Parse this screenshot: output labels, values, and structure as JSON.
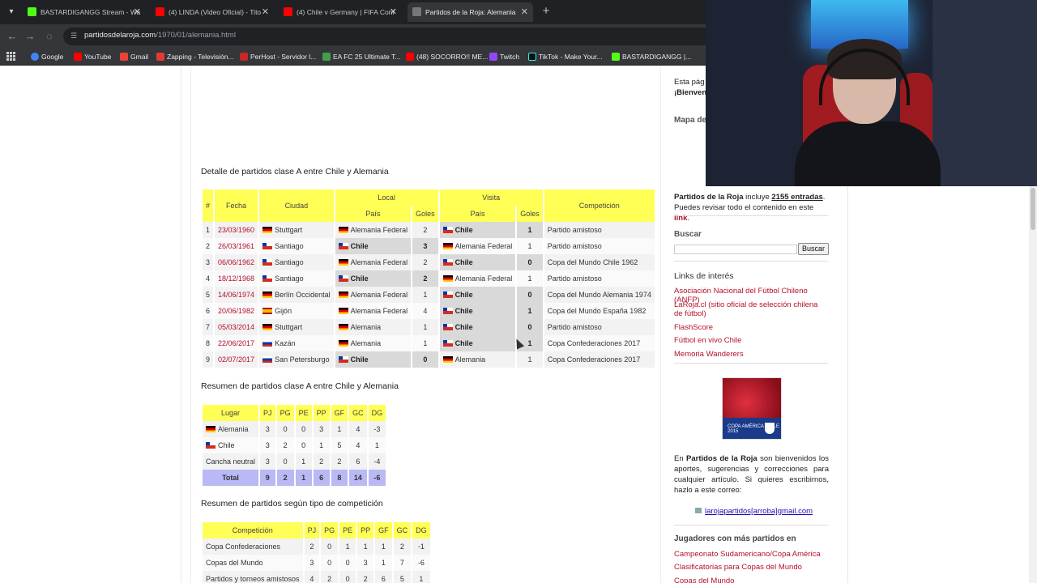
{
  "browser": {
    "tabs": [
      {
        "title": "BASTARDIGANGG Stream - Wa",
        "color": "#53fc18"
      },
      {
        "title": "(4) LINDA (Video Oficial) - Tito",
        "color": "#ff0000"
      },
      {
        "title": "(4) Chile v Germany | FIFA Conf",
        "color": "#ff0000"
      },
      {
        "title": "Partidos de la Roja: Alemania",
        "color": "#777777"
      }
    ],
    "url_host": "partidosdelaroja.com",
    "url_path": "/1970/01/alemania.html",
    "bookmarks": [
      {
        "label": "Google",
        "color": "#4285f4"
      },
      {
        "label": "YouTube",
        "color": "#ff0000"
      },
      {
        "label": "Gmail",
        "color": "#ea4335"
      },
      {
        "label": "Zapping - Televisión...",
        "color": "#e53935"
      },
      {
        "label": "PerHost - Servidor l...",
        "color": "#c62828"
      },
      {
        "label": "EA FC 25 Ultimate T...",
        "color": "#43a047"
      },
      {
        "label": "(48) SOCORRO!! ME...",
        "color": "#ff0000"
      },
      {
        "label": "Twitch",
        "color": "#9146ff"
      },
      {
        "label": "TikTok - Make Your...",
        "color": "#111111"
      },
      {
        "label": "BASTARDIGANGG |...",
        "color": "#53fc18"
      }
    ]
  },
  "detail": {
    "title": "Detalle de partidos clase A entre Chile y Alemania",
    "headers": {
      "num": "#",
      "date": "Fecha",
      "city": "Ciudad",
      "local": "Local",
      "visit": "Visita",
      "country": "País",
      "goals": "Goles",
      "competition": "Competición"
    },
    "rows": [
      {
        "n": "1",
        "date": "23/03/1960",
        "city": "Stuttgart",
        "city_flag": "de",
        "home": "Alemania Federal",
        "home_flag": "de",
        "hg": "2",
        "away": "Chile",
        "away_flag": "cl",
        "ag": "1",
        "comp": "Partido amistoso",
        "winner": "home"
      },
      {
        "n": "2",
        "date": "26/03/1961",
        "city": "Santiago",
        "city_flag": "cl",
        "home": "Chile",
        "home_flag": "cl",
        "hg": "3",
        "away": "Alemania Federal",
        "away_flag": "de",
        "ag": "1",
        "comp": "Partido amistoso",
        "winner": "home"
      },
      {
        "n": "3",
        "date": "06/06/1962",
        "city": "Santiago",
        "city_flag": "cl",
        "home": "Alemania Federal",
        "home_flag": "de",
        "hg": "2",
        "away": "Chile",
        "away_flag": "cl",
        "ag": "0",
        "comp": "Copa del Mundo Chile 1962",
        "winner": "home"
      },
      {
        "n": "4",
        "date": "18/12/1968",
        "city": "Santiago",
        "city_flag": "cl",
        "home": "Chile",
        "home_flag": "cl",
        "hg": "2",
        "away": "Alemania Federal",
        "away_flag": "de",
        "ag": "1",
        "comp": "Partido amistoso",
        "winner": "home"
      },
      {
        "n": "5",
        "date": "14/06/1974",
        "city": "Berlín Occidental",
        "city_flag": "de",
        "home": "Alemania Federal",
        "home_flag": "de",
        "hg": "1",
        "away": "Chile",
        "away_flag": "cl",
        "ag": "0",
        "comp": "Copa del Mundo Alemania 1974",
        "winner": "home"
      },
      {
        "n": "6",
        "date": "20/06/1982",
        "city": "Gijón",
        "city_flag": "es",
        "home": "Alemania Federal",
        "home_flag": "de",
        "hg": "4",
        "away": "Chile",
        "away_flag": "cl",
        "ag": "1",
        "comp": "Copa del Mundo España 1982",
        "winner": "home"
      },
      {
        "n": "7",
        "date": "05/03/2014",
        "city": "Stuttgart",
        "city_flag": "de",
        "home": "Alemania",
        "home_flag": "de",
        "hg": "1",
        "away": "Chile",
        "away_flag": "cl",
        "ag": "0",
        "comp": "Partido amistoso",
        "winner": "home"
      },
      {
        "n": "8",
        "date": "22/06/2017",
        "city": "Kazán",
        "city_flag": "ru",
        "home": "Alemania",
        "home_flag": "de",
        "hg": "1",
        "away": "Chile",
        "away_flag": "cl",
        "ag": "1",
        "comp": "Copa Confederaciones 2017",
        "winner": "none"
      },
      {
        "n": "9",
        "date": "02/07/2017",
        "city": "San Petersburgo",
        "city_flag": "ru",
        "home": "Chile",
        "home_flag": "cl",
        "hg": "0",
        "away": "Alemania",
        "away_flag": "de",
        "ag": "1",
        "comp": "Copa Confederaciones 2017",
        "winner": "home"
      }
    ]
  },
  "summary": {
    "title": "Resumen de partidos clase A entre Chile y Alemania",
    "headers": [
      "Lugar",
      "PJ",
      "PG",
      "PE",
      "PP",
      "GF",
      "GC",
      "DG"
    ],
    "rows": [
      {
        "label": "Alemania",
        "flag": "de",
        "vals": [
          "3",
          "0",
          "0",
          "3",
          "1",
          "4",
          "-3"
        ]
      },
      {
        "label": "Chile",
        "flag": "cl",
        "vals": [
          "3",
          "2",
          "0",
          "1",
          "5",
          "4",
          "1"
        ]
      },
      {
        "label": "Cancha neutral",
        "flag": "",
        "vals": [
          "3",
          "0",
          "1",
          "2",
          "2",
          "6",
          "-4"
        ]
      }
    ],
    "total": {
      "label": "Total",
      "vals": [
        "9",
        "2",
        "1",
        "6",
        "8",
        "14",
        "-6"
      ]
    }
  },
  "competition": {
    "title": "Resumen de partidos según tipo de competición",
    "headers": [
      "Competición",
      "PJ",
      "PG",
      "PE",
      "PP",
      "GF",
      "GC",
      "DG"
    ],
    "rows": [
      {
        "label": "Copa Confederaciones",
        "vals": [
          "2",
          "0",
          "1",
          "1",
          "1",
          "2",
          "-1"
        ]
      },
      {
        "label": "Copas del Mundo",
        "vals": [
          "3",
          "0",
          "0",
          "3",
          "1",
          "7",
          "-6"
        ]
      },
      {
        "label": "Partidos y torneos amistosos",
        "vals": [
          "4",
          "2",
          "0",
          "2",
          "6",
          "5",
          "1"
        ]
      }
    ]
  },
  "sidebar": {
    "intro_fragment": "Esta pág",
    "welcome_fragment": "¡Bienveni",
    "map_heading_fragment": "Mapa de",
    "entries_prefix": "Partidos de la Roja",
    "entries_mid": " incluye ",
    "entries_count": "2155 entradas",
    "entries_line2": "Puedes revisar todo el contenido en este ",
    "entries_link": "link",
    "search_heading": "Buscar",
    "search_button": "Buscar",
    "links_heading": "Links de interés",
    "links": [
      "Asociación Nacional del Fútbol Chileno (ANFP)",
      "LaRoja.cl (sitio oficial de selección chilena de fútbol)",
      "FlashScore",
      "Fútbol en vivo Chile",
      "Memoria Wanderers"
    ],
    "promo_caption": "COPA AMÉRICA CHILE 2015",
    "welcome_text_1": "En ",
    "welcome_brand": "Partidos de la Roja",
    "welcome_text_2": " son bienvenidos los aportes, sugerencias y correcciones para cualquier artículo. Si quieres escribirnos, hazlo a este correo:",
    "email": "larojapartidos[arroba]gmail.com",
    "players_heading": "Jugadores con más partidos en",
    "player_links": [
      "Campeonato Sudamericano/Copa América",
      "Clasificatorias para Copas del Mundo",
      "Copas del Mundo"
    ]
  }
}
